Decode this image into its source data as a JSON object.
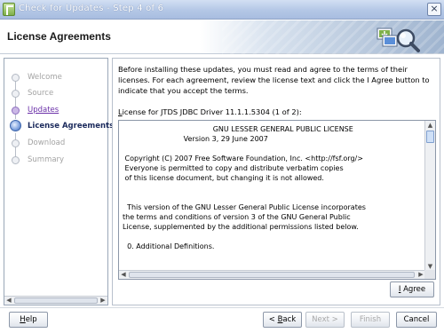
{
  "window": {
    "title": "Check for Updates - Step 4 of 6",
    "close_glyph": "×"
  },
  "header": {
    "title": "License Agreements",
    "icon": "update-search-icon"
  },
  "nav": {
    "items": [
      {
        "label": "Welcome",
        "state": "disabled"
      },
      {
        "label": "Source",
        "state": "disabled"
      },
      {
        "label": "Updates",
        "state": "visited"
      },
      {
        "label": "License Agreements",
        "state": "current"
      },
      {
        "label": "Download",
        "state": "disabled"
      },
      {
        "label": "Summary",
        "state": "disabled"
      }
    ]
  },
  "content": {
    "intro": "Before installing these updates, you must read and agree to the terms of their licenses. For each agreement, review the license text and click the I Agree button to indicate that you accept the terms.",
    "license_label_prefix": "L",
    "license_label_rest": "icense for JTDS JDBC Driver 11.1.1.5304 (1 of 2):",
    "license_text": "                                        GNU LESSER GENERAL PUBLIC LICENSE\n                           Version 3, 29 June 2007\n\n Copyright (C) 2007 Free Software Foundation, Inc. <http://fsf.org/>\n Everyone is permitted to copy and distribute verbatim copies\n of this license document, but changing it is not allowed.\n\n\n  This version of the GNU Lesser General Public License incorporates\nthe terms and conditions of version 3 of the GNU General Public\nLicense, supplemented by the additional permissions listed below.\n\n  0. Additional Definitions.",
    "agree_button": {
      "mnemonic": "I",
      "rest": " Agree"
    }
  },
  "footer": {
    "help": {
      "mnemonic": "H",
      "rest": "elp"
    },
    "back": {
      "prefix": "< ",
      "mnemonic": "B",
      "rest": "ack"
    },
    "next": "Next >",
    "finish": "Finish",
    "cancel": "Cancel"
  }
}
